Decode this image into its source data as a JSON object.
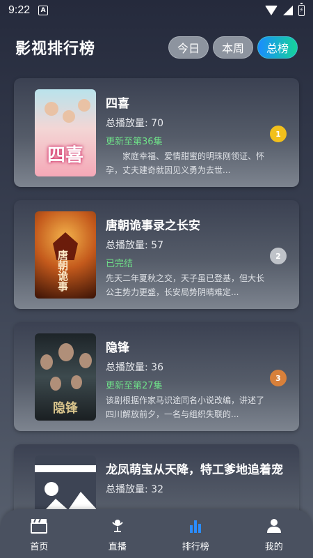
{
  "status_bar": {
    "time": "9:22",
    "a_icon": "A",
    "icons": [
      "notification-a-icon",
      "wifi-icon",
      "signal-icon",
      "battery-charging-icon"
    ]
  },
  "header": {
    "title": "影视排行榜",
    "tabs": [
      {
        "label": "今日",
        "active": false
      },
      {
        "label": "本周",
        "active": false
      },
      {
        "label": "总榜",
        "active": true
      }
    ]
  },
  "items": [
    {
      "title": "四喜",
      "plays": "总播放量: 70",
      "status": "更新至第36集",
      "description": "家庭幸福、爱情甜蜜的明珠刚领证、怀孕，丈夫建奇就因见义勇为去世...",
      "rank": "1",
      "rank_color": "#f2c01c",
      "poster_text": "四喜"
    },
    {
      "title": "唐朝诡事录之长安",
      "plays": "总播放量: 57",
      "status": "已完结",
      "description": "先天二年夏秋之交，天子虽已登基，但大长公主势力更盛，长安局势阴晴难定...",
      "rank": "2",
      "rank_color": "#bfc3c9",
      "poster_text": "唐朝诡事"
    },
    {
      "title": "隐锋",
      "plays": "总播放量: 36",
      "status": "更新至第27集",
      "description": "该剧根据作家马识途同名小说改编，讲述了四川解放前夕，一名与组织失联的...",
      "rank": "3",
      "rank_color": "#d8803a",
      "poster_text": "隐锋"
    },
    {
      "title": "龙凤萌宝从天降，特工爹地追着宠",
      "plays": "总播放量: 32",
      "status": "",
      "description": "",
      "rank": "",
      "rank_color": "",
      "poster_text": ""
    }
  ],
  "bottom_nav": [
    {
      "label": "首页",
      "icon": "clapperboard-icon",
      "active": false
    },
    {
      "label": "直播",
      "icon": "microphone-icon",
      "active": false
    },
    {
      "label": "排行榜",
      "icon": "bar-chart-icon",
      "active": true
    },
    {
      "label": "我的",
      "icon": "user-icon",
      "active": false
    }
  ]
}
